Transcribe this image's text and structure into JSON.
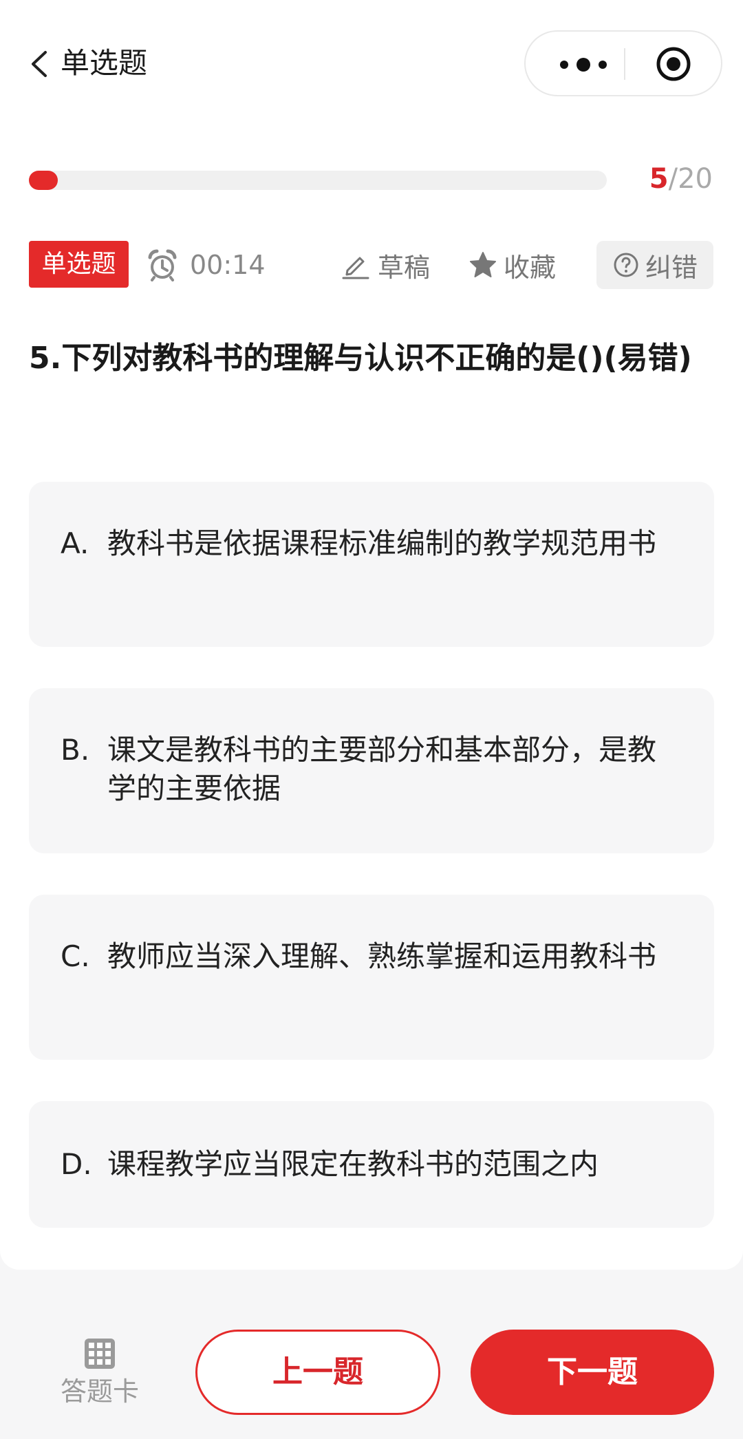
{
  "header": {
    "title": "单选题"
  },
  "progress": {
    "current": "5",
    "separator": "/",
    "total": "20",
    "fraction": 0.05
  },
  "toolbar": {
    "type_badge": "单选题",
    "timer": "00:14",
    "draft_label": "草稿",
    "favorite_label": "收藏",
    "report_label": "纠错"
  },
  "question": {
    "text": "5.下列对教科书的理解与认识不正确的是()(易错)"
  },
  "options": [
    {
      "letter": "A.",
      "text": "教科书是依据课程标准编制的教学规范用书"
    },
    {
      "letter": "B.",
      "text": "课文是教科书的主要部分和基本部分，是教学的主要依据"
    },
    {
      "letter": "C.",
      "text": "教师应当深入理解、熟练掌握和运用教科书"
    },
    {
      "letter": "D.",
      "text": "课程教学应当限定在教科书的范围之内"
    }
  ],
  "bottom": {
    "answer_card_label": "答题卡",
    "prev_label": "上一题",
    "next_label": "下一题"
  },
  "colors": {
    "accent": "#e42a2a",
    "option_bg": "#f6f6f7"
  },
  "icons": [
    "back-arrow-icon",
    "more-dots-icon",
    "target-icon",
    "alarm-clock-icon",
    "pencil-icon",
    "star-icon",
    "question-circle-icon",
    "grid-icon"
  ]
}
